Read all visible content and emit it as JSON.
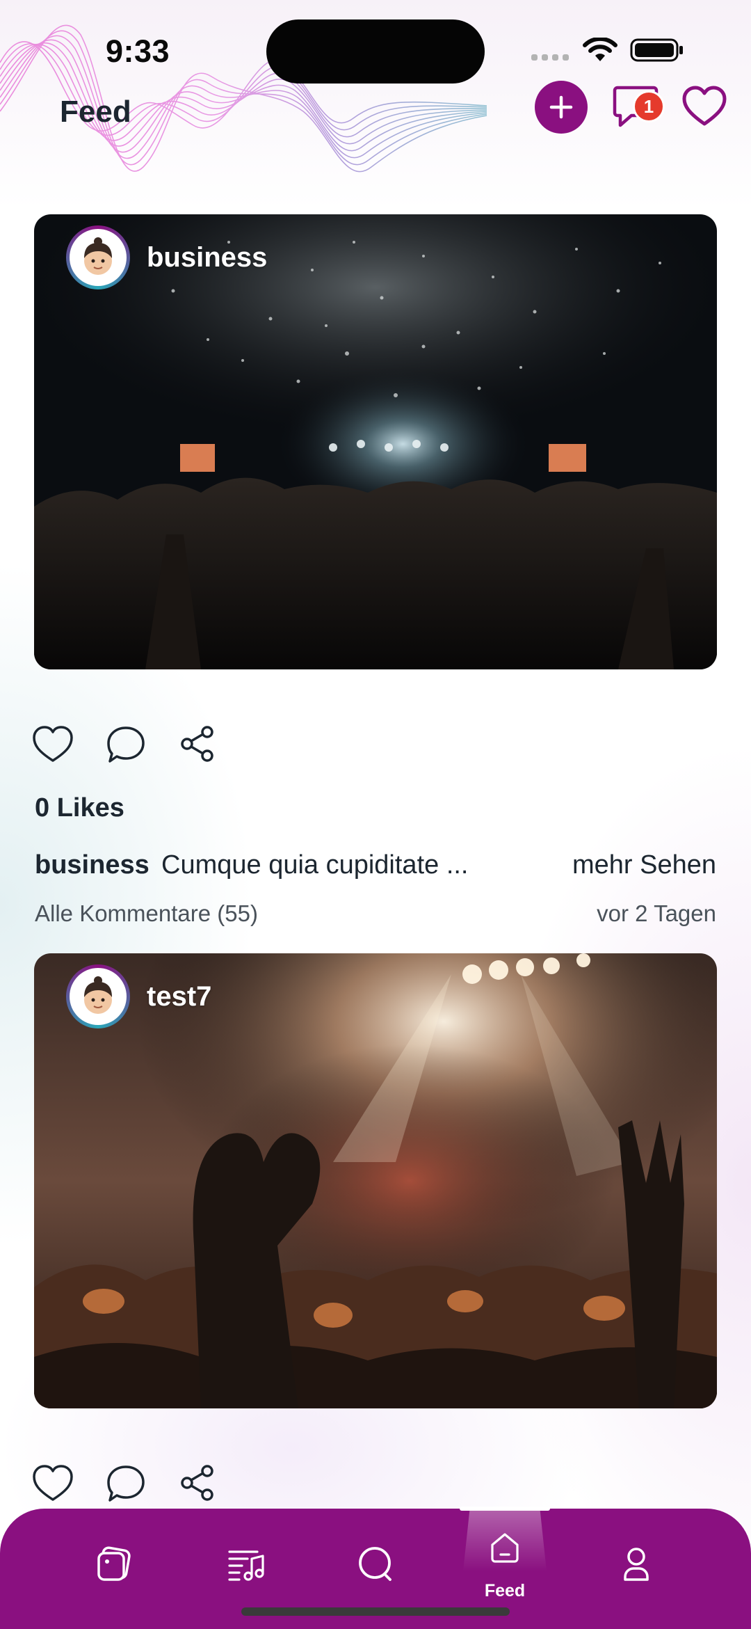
{
  "status_bar": {
    "time": "9:33"
  },
  "header": {
    "title": "Feed",
    "message_badge_count": "1",
    "accent_color": "#8a1080",
    "icons": [
      "plus-icon",
      "message-icon",
      "heart-icon"
    ]
  },
  "posts": [
    {
      "username": "business",
      "likes_label": "0 Likes",
      "caption_user": "business",
      "caption_text": "Cumque quia cupiditate ...",
      "more_label": "mehr Sehen",
      "comments_label": "Alle Kommentare (55)",
      "time_label": "vor 2 Tagen"
    },
    {
      "username": "test7"
    }
  ],
  "bottom_nav": {
    "items": [
      {
        "icon": "cards-icon",
        "label": ""
      },
      {
        "icon": "playlist-icon",
        "label": ""
      },
      {
        "icon": "search-icon",
        "label": ""
      },
      {
        "icon": "home-icon",
        "label": "Feed",
        "active": true
      },
      {
        "icon": "profile-icon",
        "label": ""
      }
    ]
  }
}
